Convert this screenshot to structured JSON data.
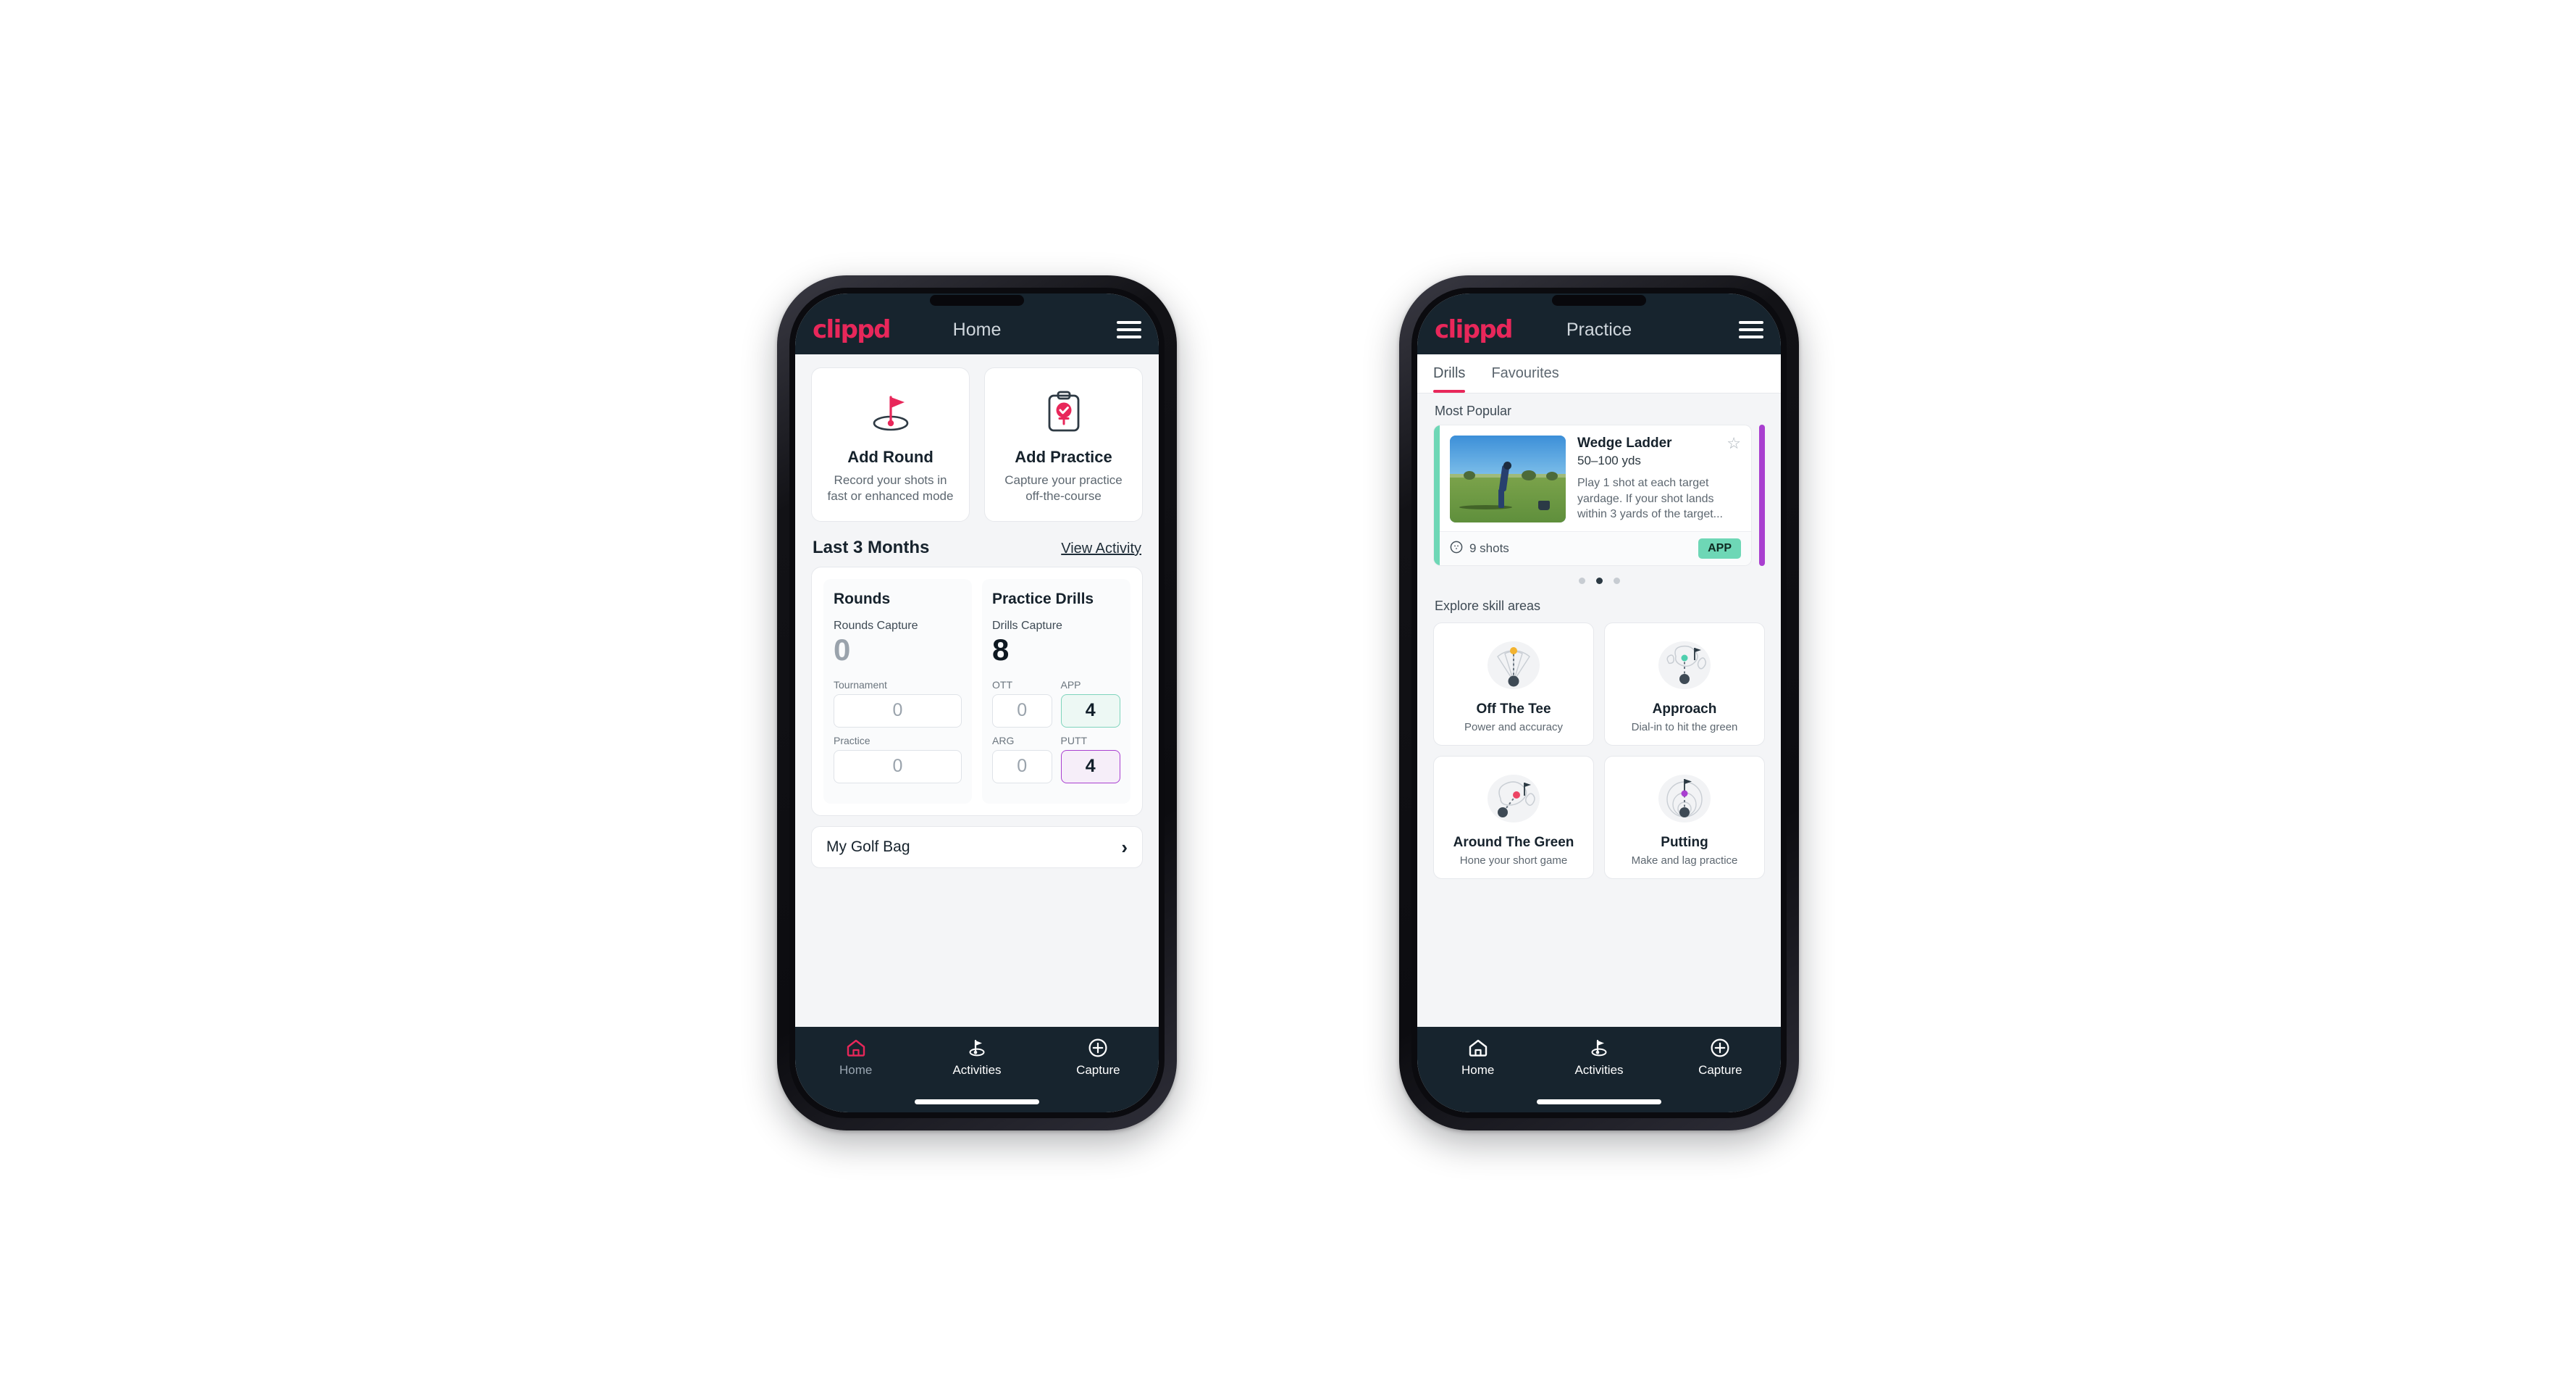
{
  "brand": {
    "logo_text": "clippd",
    "accent_pink": "#e8275a",
    "header_bg": "#17242e",
    "teal": "#6ed7b6",
    "purple": "#a93fd0"
  },
  "phone_home": {
    "header": {
      "title": "Home",
      "menu_icon": "hamburger-menu-icon"
    },
    "actions": [
      {
        "icon": "golf-flag-hole-icon",
        "title": "Add Round",
        "subtitle_line1": "Record your shots in",
        "subtitle_line2": "fast or enhanced mode"
      },
      {
        "icon": "clipboard-check-icon",
        "title": "Add Practice",
        "subtitle_line1": "Capture your practice",
        "subtitle_line2": "off-the-course"
      }
    ],
    "section": {
      "title": "Last 3 Months",
      "link": "View Activity"
    },
    "stats": {
      "rounds": {
        "heading": "Rounds",
        "capture_label": "Rounds Capture",
        "capture_value": "0",
        "metrics": [
          {
            "label": "Tournament",
            "value": "0",
            "state": "zero"
          },
          {
            "label": "Practice",
            "value": "0",
            "state": "zero"
          }
        ]
      },
      "drills": {
        "heading": "Practice Drills",
        "capture_label": "Drills Capture",
        "capture_value": "8",
        "metrics": [
          {
            "label": "OTT",
            "value": "0",
            "state": "zero"
          },
          {
            "label": "APP",
            "value": "4",
            "state": "app"
          },
          {
            "label": "ARG",
            "value": "0",
            "state": "zero"
          },
          {
            "label": "PUTT",
            "value": "4",
            "state": "putt"
          }
        ]
      }
    },
    "golf_bag": {
      "label": "My Golf Bag",
      "chevron": "›"
    },
    "bottom_nav": [
      {
        "label": "Home",
        "icon": "home-icon",
        "active": true
      },
      {
        "label": "Activities",
        "icon": "golf-flag-icon",
        "active": false
      },
      {
        "label": "Capture",
        "icon": "plus-circle-icon",
        "active": false
      }
    ]
  },
  "phone_practice": {
    "header": {
      "title": "Practice",
      "menu_icon": "hamburger-menu-icon"
    },
    "tabs": [
      {
        "label": "Drills",
        "active": true
      },
      {
        "label": "Favourites",
        "active": false
      }
    ],
    "most_popular_label": "Most Popular",
    "drill": {
      "title": "Wedge Ladder",
      "yardage": "50–100 yds",
      "description": "Play 1 shot at each target yardage. If your shot lands within 3 yards of the target...",
      "shots": "9 shots",
      "shots_icon": "golf-ball-icon",
      "badge": "APP",
      "star_icon": "star-outline-icon",
      "accent_color": "#6ed7b6",
      "next_card_accent": "#a93fd0"
    },
    "carousel_dots": {
      "count": 3,
      "active_index": 1
    },
    "explore_label": "Explore skill areas",
    "skills": [
      {
        "title": "Off The Tee",
        "subtitle": "Power and accuracy",
        "icon": "tee-shot-dispersion-icon",
        "dot_color": "#f3b330"
      },
      {
        "title": "Approach",
        "subtitle": "Dial-in to hit the green",
        "icon": "approach-green-icon",
        "dot_color": "#4ecfae"
      },
      {
        "title": "Around The Green",
        "subtitle": "Hone your short game",
        "icon": "chip-green-icon",
        "dot_color": "#ec4464"
      },
      {
        "title": "Putting",
        "subtitle": "Make and lag practice",
        "icon": "putting-rings-icon",
        "dot_color": "#a93fd0"
      }
    ],
    "bottom_nav": [
      {
        "label": "Home",
        "icon": "home-icon",
        "active": false
      },
      {
        "label": "Activities",
        "icon": "golf-flag-icon",
        "active": true
      },
      {
        "label": "Capture",
        "icon": "plus-circle-icon",
        "active": false
      }
    ]
  }
}
